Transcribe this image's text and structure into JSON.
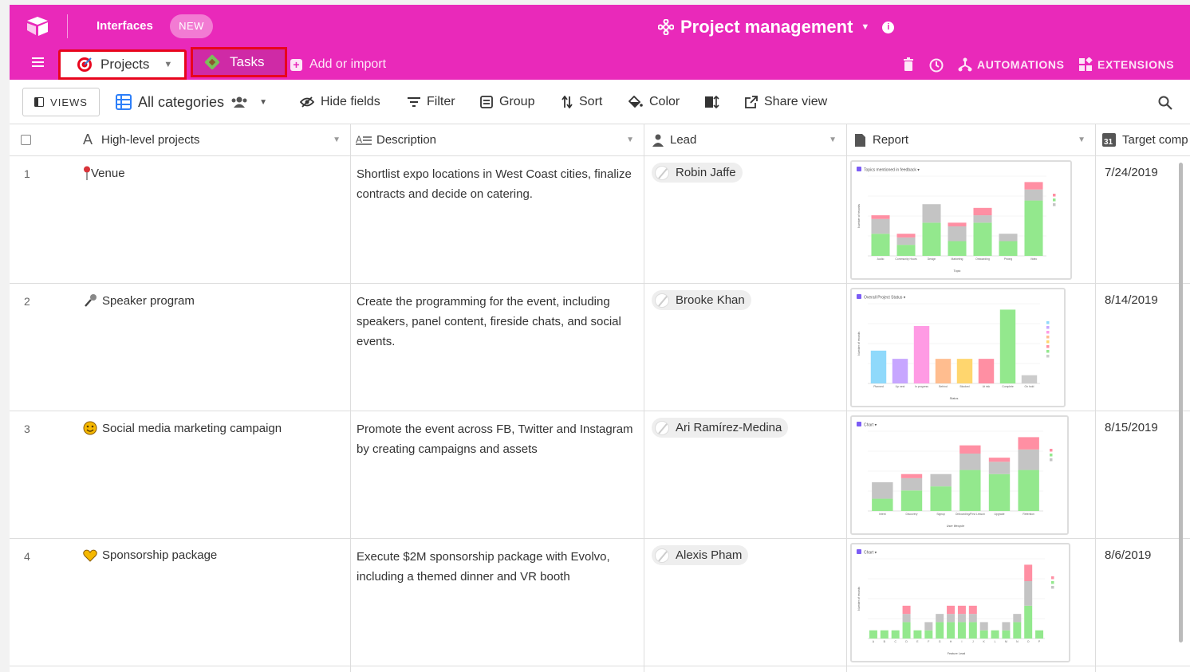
{
  "topbar": {
    "interfaces_label": "Interfaces",
    "new_badge": "NEW",
    "base_title": "Project management",
    "tabs": [
      {
        "label": "Projects"
      },
      {
        "label": "Tasks"
      }
    ],
    "add_import_label": "Add or import",
    "automations_label": "AUTOMATIONS",
    "extensions_label": "EXTENSIONS"
  },
  "viewbar": {
    "views_label": "VIEWS",
    "view_name": "All categories",
    "hide_fields": "Hide fields",
    "filter": "Filter",
    "group": "Group",
    "sort": "Sort",
    "color": "Color",
    "share_view": "Share view"
  },
  "columns": [
    {
      "label": "High-level projects"
    },
    {
      "label": "Description"
    },
    {
      "label": "Lead"
    },
    {
      "label": "Report"
    },
    {
      "label": "Target comp"
    }
  ],
  "rows": [
    {
      "num": "1",
      "name": "Venue",
      "icon": "pin-icon",
      "description": "Shortlist expo locations in West Coast cities, finalize contracts and decide on catering.",
      "lead": "Robin Jaffe",
      "target": "7/24/2019",
      "report_title": "Topics mentioned in feedback",
      "report_xlabel": "Topic",
      "report_ylabel": "Number of records",
      "report_categories": [
        "Audio",
        "Community Hours",
        "Design",
        "Marketing",
        "Onboarding",
        "Pricing",
        "Video"
      ],
      "report_stacks": [
        [
          6,
          4,
          1
        ],
        [
          3,
          2,
          1
        ],
        [
          9,
          5,
          0
        ],
        [
          4,
          4,
          1
        ],
        [
          9,
          2,
          2
        ],
        [
          4,
          2,
          0
        ],
        [
          15,
          3,
          2
        ]
      ]
    },
    {
      "num": "2",
      "name": "Speaker program",
      "icon": "microphone-icon",
      "description": "Create the programming for the event, including speakers, panel content, fireside chats, and social events.",
      "lead": "Brooke Khan",
      "target": "8/14/2019",
      "report_title": "Overall Project Status",
      "report_xlabel": "Status",
      "report_ylabel": "Number of records",
      "report_categories": [
        "Planned",
        "Up next",
        "In progress",
        "Behind",
        "Blocked",
        "At risk",
        "Complete",
        "On hold"
      ],
      "report_values": [
        4,
        3,
        7,
        3,
        3,
        3,
        9,
        1
      ],
      "report_colors": [
        "#8fd9fb",
        "#c7a6ff",
        "#ff9be4",
        "#ffbd8f",
        "#ffd66e",
        "#ff8fa3",
        "#93e88d",
        "#cccccc"
      ]
    },
    {
      "num": "3",
      "name": "Social media marketing campaign",
      "icon": "emoji-icon",
      "description": "Promote the event across FB, Twitter and Instagram by creating campaigns and assets",
      "lead": "Ari Ramírez-Medina",
      "target": "8/15/2019",
      "report_title": "Chart",
      "report_xlabel": "User lifecycle",
      "report_ylabel": "",
      "report_categories": [
        "Intent",
        "Discovery",
        "Signup",
        "Onboarding/First Lesson",
        "Upgrade",
        "Retention"
      ],
      "report_stacks": [
        [
          3,
          4,
          0
        ],
        [
          5,
          3,
          1
        ],
        [
          6,
          3,
          0
        ],
        [
          10,
          4,
          2
        ],
        [
          9,
          3,
          1
        ],
        [
          10,
          5,
          3
        ]
      ]
    },
    {
      "num": "4",
      "name": "Sponsorship package",
      "icon": "heart-icon",
      "description": "Execute $2M sponsorship package with Evolvo, including a themed dinner and VR booth",
      "lead": "Alexis Pham",
      "target": "8/6/2019",
      "report_title": "Chart",
      "report_xlabel": "Feature Lead",
      "report_ylabel": "Number of records",
      "report_categories": [
        "A",
        "B",
        "C",
        "D",
        "E",
        "F",
        "G",
        "H",
        "I",
        "J",
        "K",
        "L",
        "M",
        "N",
        "O",
        "P"
      ],
      "report_stacks": [
        [
          1,
          0,
          0
        ],
        [
          1,
          0,
          0
        ],
        [
          1,
          0,
          0
        ],
        [
          2,
          1,
          1
        ],
        [
          1,
          0,
          0
        ],
        [
          1,
          1,
          0
        ],
        [
          2,
          1,
          0
        ],
        [
          2,
          1,
          1
        ],
        [
          2,
          1,
          1
        ],
        [
          2,
          1,
          1
        ],
        [
          1,
          1,
          0
        ],
        [
          1,
          0,
          0
        ],
        [
          1,
          1,
          0
        ],
        [
          2,
          1,
          0
        ],
        [
          4,
          3,
          2
        ],
        [
          1,
          0,
          0
        ]
      ]
    }
  ],
  "colors": {
    "brand": "#e929ba",
    "highlight_border": "#e8051d",
    "chart_green": "#93e88d",
    "chart_gray": "#c4c4c4",
    "chart_pink": "#ff8fa3"
  }
}
